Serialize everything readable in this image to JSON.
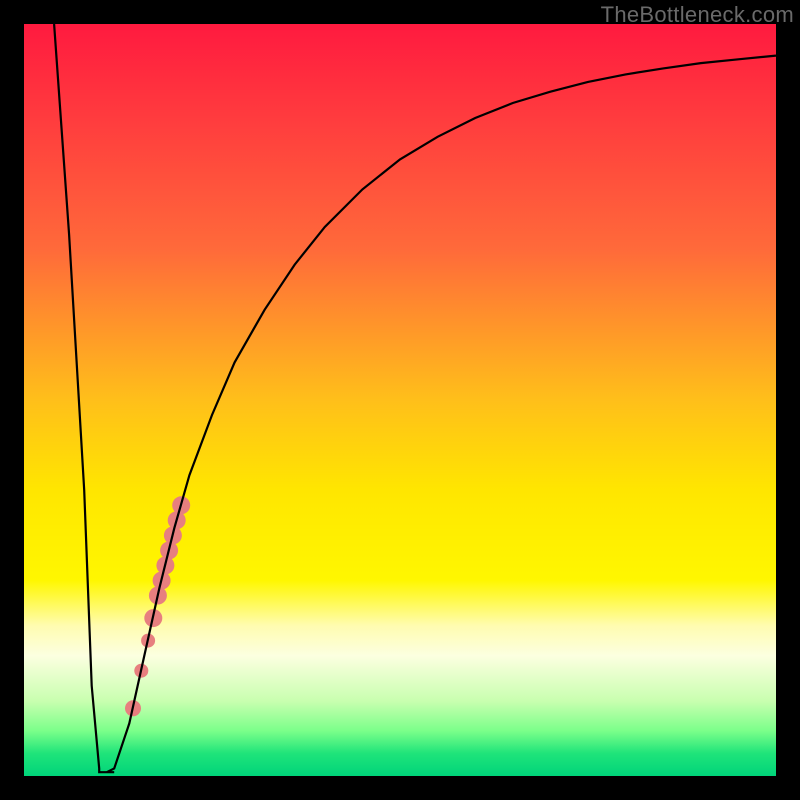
{
  "watermark": "TheBottleneck.com",
  "colors": {
    "frame": "#000000",
    "curve": "#000000",
    "marker": "#e77f7f",
    "gradient_stops": [
      {
        "offset": 0.0,
        "color": "#ff1a3f"
      },
      {
        "offset": 0.12,
        "color": "#ff3a3e"
      },
      {
        "offset": 0.3,
        "color": "#ff6a3a"
      },
      {
        "offset": 0.5,
        "color": "#ffbf1a"
      },
      {
        "offset": 0.62,
        "color": "#ffe600"
      },
      {
        "offset": 0.74,
        "color": "#fff700"
      },
      {
        "offset": 0.8,
        "color": "#fffcb0"
      },
      {
        "offset": 0.84,
        "color": "#fcffe0"
      },
      {
        "offset": 0.9,
        "color": "#c9ffb0"
      },
      {
        "offset": 0.94,
        "color": "#7bff8a"
      },
      {
        "offset": 0.97,
        "color": "#1fe47a"
      },
      {
        "offset": 1.0,
        "color": "#00d47a"
      }
    ]
  },
  "chart_data": {
    "type": "line",
    "title": "",
    "xlabel": "",
    "ylabel": "",
    "xlim": [
      0,
      100
    ],
    "ylim": [
      0,
      100
    ],
    "series": [
      {
        "name": "bottleneck-curve",
        "x": [
          4,
          6,
          8,
          9,
          10,
          11,
          12,
          14,
          16,
          18,
          20,
          22,
          25,
          28,
          32,
          36,
          40,
          45,
          50,
          55,
          60,
          65,
          70,
          75,
          80,
          85,
          90,
          95,
          100
        ],
        "y": [
          100,
          72,
          38,
          12,
          1,
          0.5,
          1,
          7,
          16,
          25,
          33,
          40,
          48,
          55,
          62,
          68,
          73,
          78,
          82,
          85,
          87.5,
          89.5,
          91,
          92.3,
          93.3,
          94.1,
          94.8,
          95.3,
          95.8
        ]
      }
    ],
    "flat_bottom": {
      "x_start": 10,
      "x_end": 12,
      "y": 0.5
    },
    "markers": {
      "name": "highlight-points",
      "points": [
        {
          "x": 14.5,
          "y": 9,
          "r": 8
        },
        {
          "x": 15.6,
          "y": 14,
          "r": 7
        },
        {
          "x": 16.5,
          "y": 18,
          "r": 7
        },
        {
          "x": 17.2,
          "y": 21,
          "r": 9
        },
        {
          "x": 17.8,
          "y": 24,
          "r": 9
        },
        {
          "x": 18.3,
          "y": 26,
          "r": 9
        },
        {
          "x": 18.8,
          "y": 28,
          "r": 9
        },
        {
          "x": 19.3,
          "y": 30,
          "r": 9
        },
        {
          "x": 19.8,
          "y": 32,
          "r": 9
        },
        {
          "x": 20.3,
          "y": 34,
          "r": 9
        },
        {
          "x": 20.9,
          "y": 36,
          "r": 9
        }
      ]
    }
  }
}
